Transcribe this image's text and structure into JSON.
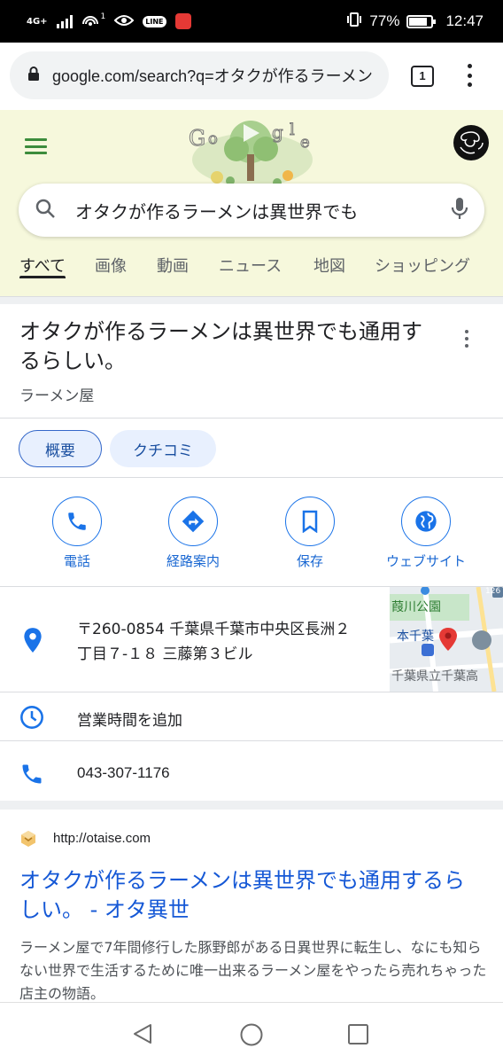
{
  "status_bar": {
    "network": "4G+",
    "sim_indicator": "1",
    "line_label": "LINE",
    "battery": "77%",
    "time": "12:47"
  },
  "browser": {
    "url": "google.com/search?q=オタクが作るラーメン",
    "tab_count": "1"
  },
  "search": {
    "query": "オタクが作るラーメンは異世界でも"
  },
  "tabs": [
    {
      "label": "すべて",
      "active": true
    },
    {
      "label": "画像"
    },
    {
      "label": "動画"
    },
    {
      "label": "ニュース"
    },
    {
      "label": "地図"
    },
    {
      "label": "ショッピング"
    }
  ],
  "knowledge_panel": {
    "title": "オタクが作るラーメンは異世界でも通用するらしい。",
    "category": "ラーメン屋",
    "chips": [
      "概要",
      "クチコミ"
    ],
    "actions": [
      "電話",
      "経路案内",
      "保存",
      "ウェブサイト"
    ],
    "address_line1": "〒260-0854 千葉県千葉市中央区長洲２",
    "address_line2": "丁目７-１８ 三藤第３ビル",
    "hours": "営業時間を追加",
    "phone": "043-307-1176",
    "map": {
      "labels": [
        "葭川公園",
        "本千葉",
        "千葉県立千葉高",
        "126"
      ]
    }
  },
  "result": {
    "url": "http://otaise.com",
    "title": "オタクが作るラーメンは異世界でも通用するらしい。 - オタ異世",
    "snippet": "ラーメン屋で7年間修行した豚野郎がある日異世界に転生し、なにも知らない世界で生活するために唯一出来るラーメン屋をやったら売れちゃった店主の物語。"
  },
  "colors": {
    "link": "#1558d6",
    "accent": "#1a73e8",
    "header_bg": "#f6f8dc",
    "pin": "#1a73e8"
  }
}
